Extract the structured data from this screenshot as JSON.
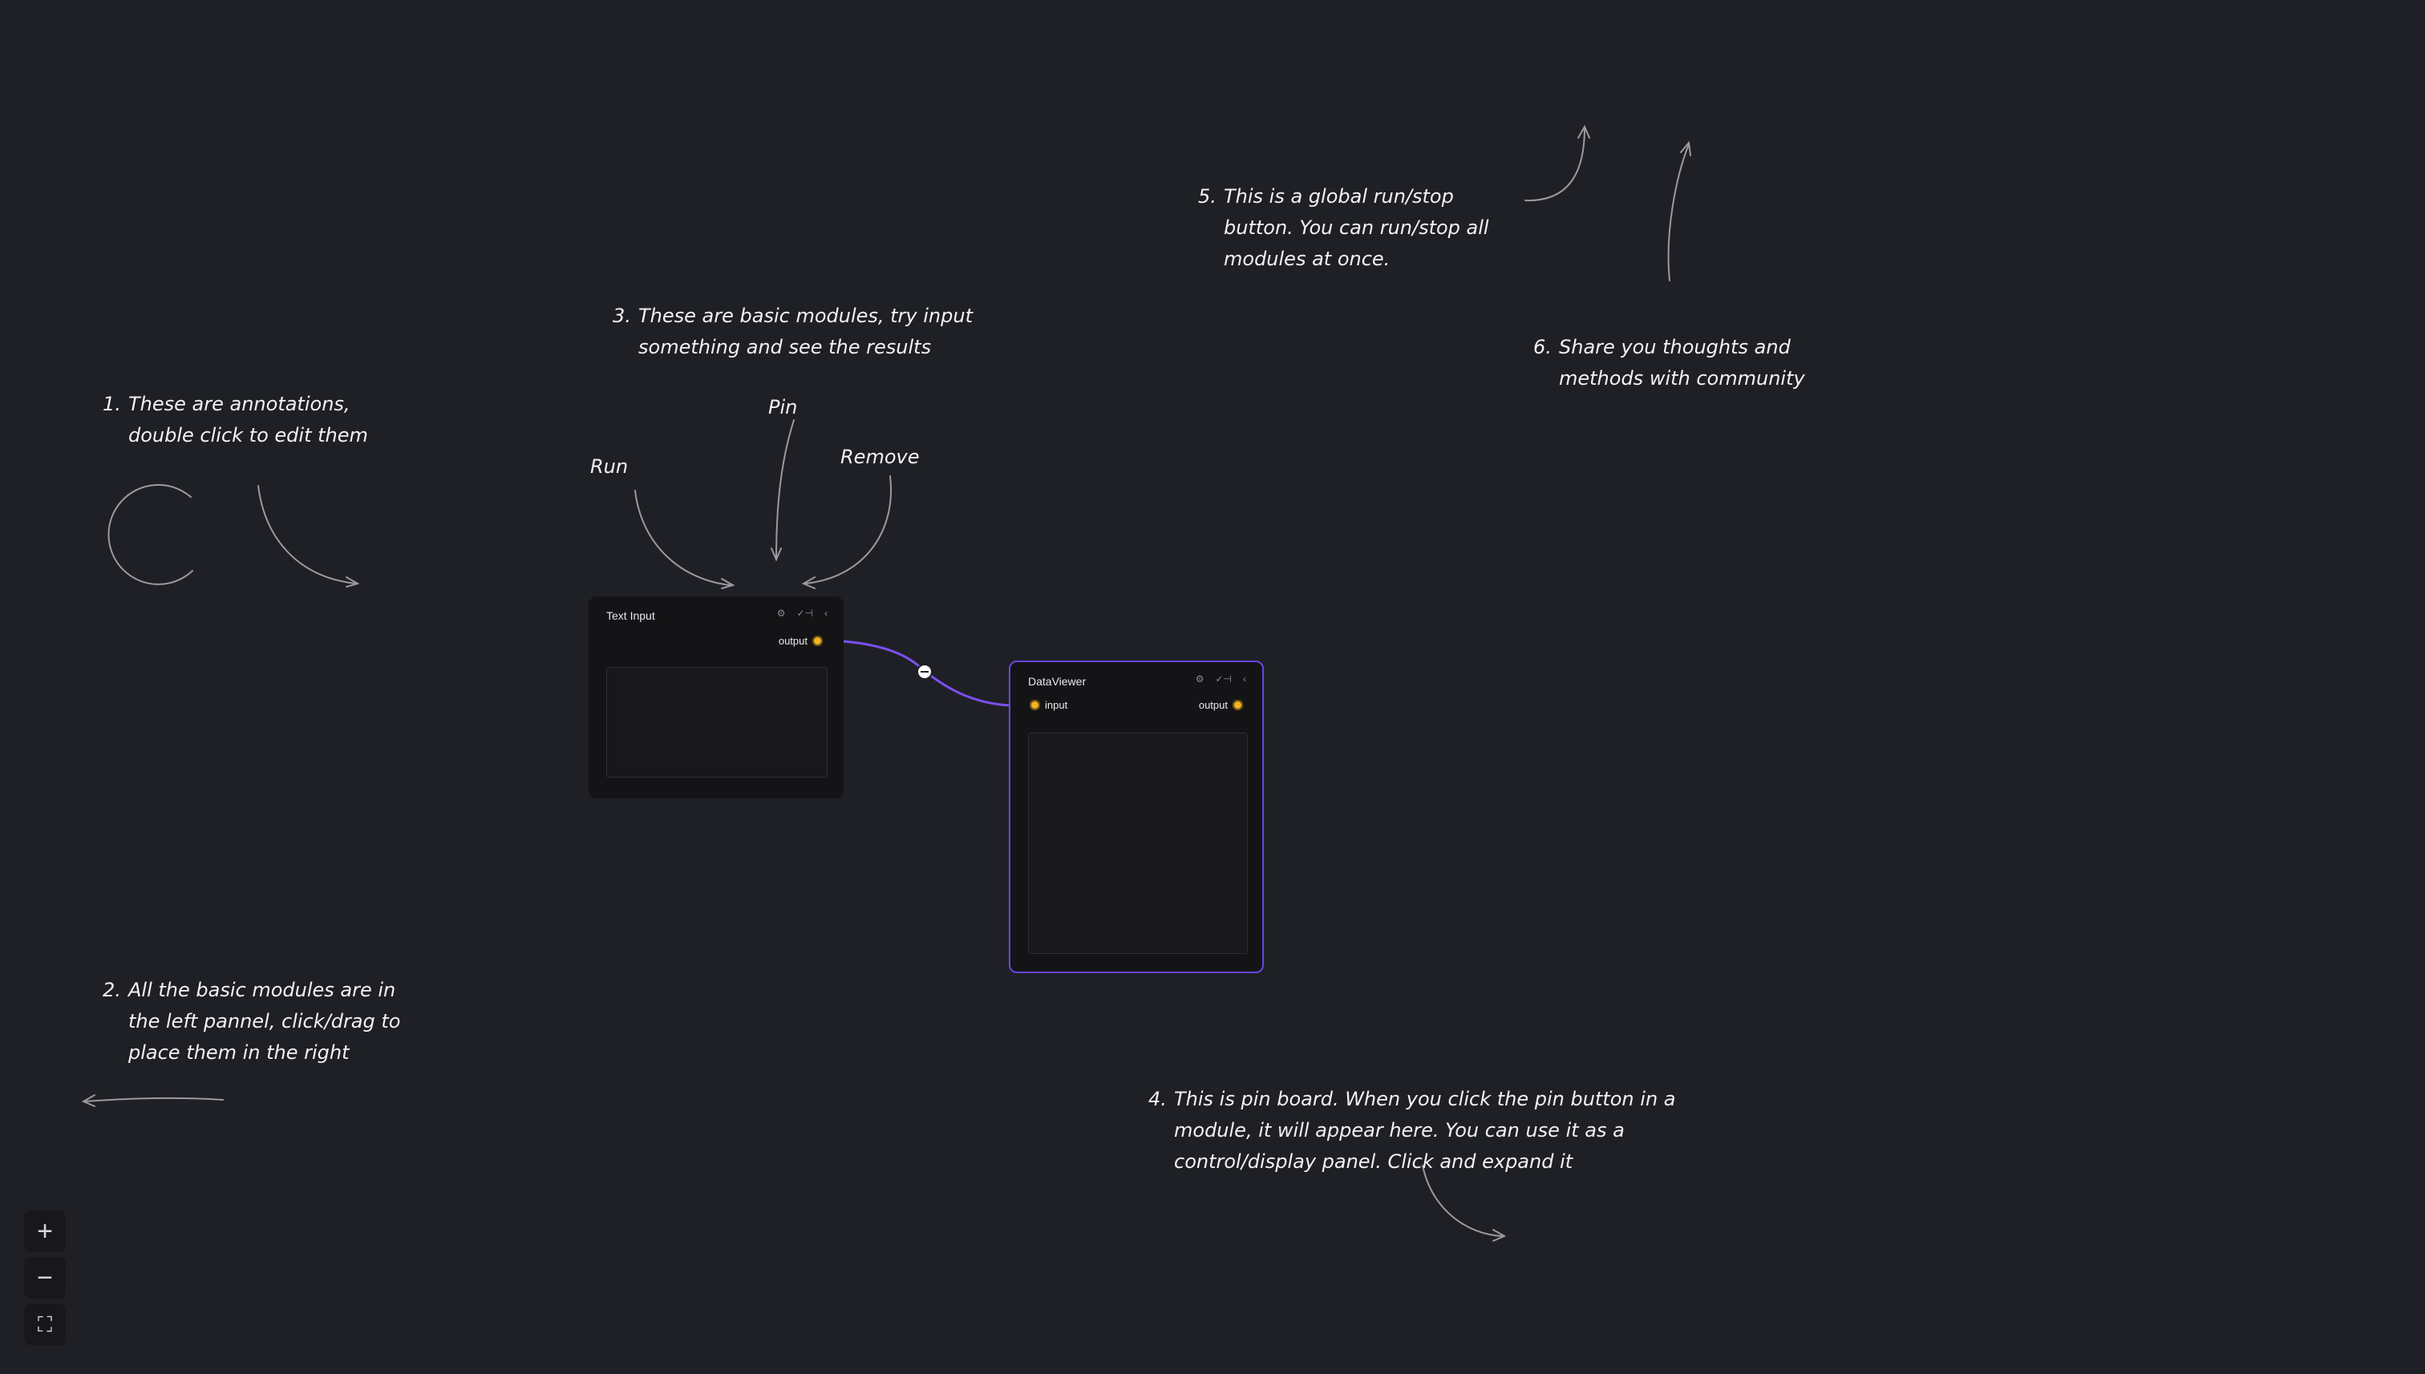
{
  "annotations": {
    "a1": {
      "num": "1.",
      "text": "These are annotations, double click to edit them"
    },
    "a2": {
      "num": "2.",
      "text": "All the basic modules are in the left pannel, click/drag to place them in the right"
    },
    "a3": {
      "num": "3.",
      "text": "These are basic modules, try input something and see the results"
    },
    "a4": {
      "num": "4.",
      "text": "This is pin board. When you click the pin button in a module, it will appear here. You can use it as a control/display panel. Click and expand it"
    },
    "a5": {
      "num": "5.",
      "text": "This is a global run/stop button. You can run/stop all modules at once."
    },
    "a6": {
      "num": "6.",
      "text": "Share you thoughts and methods with community"
    }
  },
  "labels": {
    "run": "Run",
    "pin": "Pin",
    "remove": "Remove"
  },
  "modules": {
    "text_input": {
      "title": "Text Input",
      "output": "output",
      "value": ""
    },
    "data_viewer": {
      "title": "DataViewer",
      "input": "input",
      "output": "output"
    }
  },
  "zoom_controls": {
    "zoom_in": "+",
    "zoom_out": "−",
    "fit": "⛶"
  },
  "colors": {
    "background": "#1f2025",
    "accent": "#7b4ff0",
    "port": "#f3b522"
  }
}
